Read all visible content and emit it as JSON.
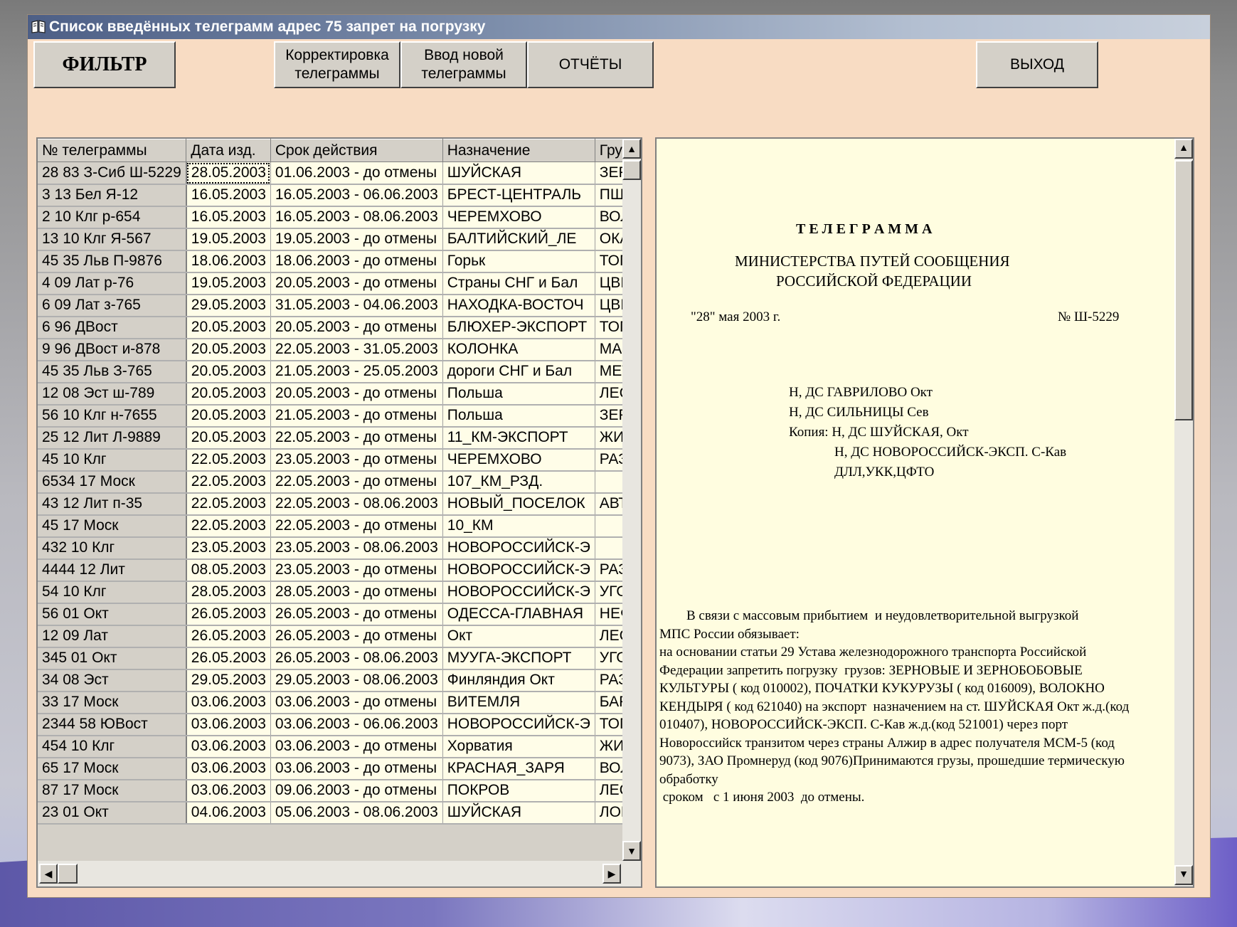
{
  "window": {
    "title": "Список введённых телеграмм  адрес 75 запрет на погрузку",
    "icon": "book-icon"
  },
  "toolbar": {
    "filter_label": "ФИЛЬТР",
    "edit_label": "Корректировка\nтелеграммы",
    "new_label": "Ввод новой\nтелеграммы",
    "reports_label": "ОТЧЁТЫ",
    "exit_label": "ВЫХОД"
  },
  "table": {
    "columns": [
      "№ телеграммы",
      "Дата изд.",
      "Срок действия",
      "Назначение",
      "Груз"
    ],
    "rows": [
      [
        "28 83 З-Сиб Ш-5229",
        "28.05.2003",
        "01.06.2003 - до отмены",
        "ШУЙСКАЯ",
        "ЗЕРНОВ"
      ],
      [
        "3 13 Бел Я-12",
        "16.05.2003",
        "16.05.2003 - 06.06.2003",
        "БРЕСТ-ЦЕНТРАЛЬ",
        "ПШЕНИЦ"
      ],
      [
        "2 10 Клг р-654",
        "16.05.2003",
        "16.05.2003 - 08.06.2003",
        "ЧЕРЕМХОВО",
        "ВОЛОКНО"
      ],
      [
        "13 10 Клг Я-567",
        "19.05.2003",
        "19.05.2003 - до отмены",
        "БАЛТИЙСКИЙ_ЛЕ",
        "ОКАТЫШ"
      ],
      [
        "45 35 Льв П-9876",
        "18.06.2003",
        "18.06.2003 - до отмены",
        "Горьк",
        "ТОПЛИВО"
      ],
      [
        "4 09 Лат р-76",
        "19.05.2003",
        "20.05.2003 - до отмены",
        "Страны СНГ и Бал",
        "ЦВЕТНЫ"
      ],
      [
        "6 09 Лат з-765",
        "29.05.2003",
        "31.05.2003 - 04.06.2003",
        "НАХОДКА-ВОСТОЧ",
        "ЦВЕТНЫ"
      ],
      [
        "6 96 ДВост",
        "20.05.2003",
        "20.05.2003 - до отмены",
        "БЛЮХЕР-ЭКСПОРТ",
        "ТОПЛИВО"
      ],
      [
        "9 96 ДВост и-878",
        "20.05.2003",
        "22.05.2003 - 31.05.2003",
        "КОЛОНКА",
        "МАЗУТ Н"
      ],
      [
        "45 35 Льв З-765",
        "20.05.2003",
        "21.05.2003 - 25.05.2003",
        "дороги СНГ и Бал",
        "МЕТАЛЛИ"
      ],
      [
        "12 08 Эст ш-789",
        "20.05.2003",
        "20.05.2003 - до отмены",
        "Польша",
        "ЛЕСМАТ"
      ],
      [
        "56 10 Клг н-7655",
        "20.05.2003",
        "21.05.2003 - до отмены",
        "Польша",
        "ЗЕРНО"
      ],
      [
        "25 12 Лит Л-9889",
        "20.05.2003",
        "22.05.2003 - до отмены",
        "11_КМ-ЭКСПОРТ",
        "ЖИВОТН"
      ],
      [
        "45 10 Клг",
        "22.05.2003",
        "23.05.2003 - до отмены",
        "ЧЕРЕМХОВО",
        "РАЗНЫЕ"
      ],
      [
        "6534 17 Моск",
        "22.05.2003",
        "22.05.2003 - до отмены",
        "107_КМ_РЗД.",
        ""
      ],
      [
        "43 12 Лит п-35",
        "22.05.2003",
        "22.05.2003 - 08.06.2003",
        "НОВЫЙ_ПОСЕЛОК",
        "АВТОМ И"
      ],
      [
        "45 17 Моск",
        "22.05.2003",
        "22.05.2003 - до отмены",
        "10_КМ",
        ""
      ],
      [
        "432 10 Клг",
        "23.05.2003",
        "23.05.2003 - 08.06.2003",
        "НОВОРОССИЙСК-Э",
        ""
      ],
      [
        "4444 12 Лит",
        "08.05.2003",
        "23.05.2003 - до отмены",
        "НОВОРОССИЙСК-Э",
        "РАЗНЫЕ"
      ],
      [
        "54 10 Клг",
        "28.05.2003",
        "28.05.2003 - до отмены",
        "НОВОРОССИЙСК-Э",
        "УГОЛЬ"
      ],
      [
        "56 01 Окт",
        "26.05.2003",
        "26.05.2003 - до отмены",
        "ОДЕССА-ГЛАВНАЯ",
        "НЕФТЬ С"
      ],
      [
        "12 09 Лат",
        "26.05.2003",
        "26.05.2003 - до отмены",
        "Окт",
        "ЛЕСНЫЕ"
      ],
      [
        "345 01 Окт",
        "26.05.2003",
        "26.05.2003 - 08.06.2003",
        "МУУГА-ЭКСПОРТ",
        "УГОЛЬ"
      ],
      [
        "34 08 Эст",
        "29.05.2003",
        "29.05.2003 - 08.06.2003",
        "Финляндия Окт",
        "РАЗНЫЕ"
      ],
      [
        "33 17 Моск",
        "03.06.2003",
        "03.06.2003 - до отмены",
        "ВИТЕМЛЯ",
        "БАРДА В"
      ],
      [
        "2344 58 ЮВост",
        "03.06.2003",
        "03.06.2003 - 06.06.2003",
        "НОВОРОССИЙСК-Э",
        "ТОПЛИВО"
      ],
      [
        "454 10 Клг",
        "03.06.2003",
        "03.06.2003 - до отмены",
        "Хорватия",
        "ЖИВОТН"
      ],
      [
        "65 17 Моск",
        "03.06.2003",
        "03.06.2003 - до отмены",
        "КРАСНАЯ_ЗАРЯ",
        "ВОЛОКНО"
      ],
      [
        "87 17 Моск",
        "03.06.2003",
        "09.06.2003 - до отмены",
        "ПОКРОВ",
        "ЛЕСНЫЕ"
      ],
      [
        "23 01 Окт",
        "04.06.2003",
        "05.06.2003 - 08.06.2003",
        "ШУЙСКАЯ",
        "ЛОМ СТ С"
      ]
    ]
  },
  "document": {
    "heading": "Т Е Л Е Г Р А М М А",
    "ministry_1": "МИНИСТЕРСТВА ПУТЕЙ СООБЩЕНИЯ",
    "ministry_2": "РОССИЙСКОЙ ФЕДЕРАЦИИ",
    "date": "\"28\" мая 2003 г.",
    "number": "№ Ш-5229",
    "addr_1": "Н, ДС ГАВРИЛОВО Окт",
    "addr_2": "Н, ДС СИЛЬНИЦЫ Сев",
    "addr_3": "Копия: Н, ДС  ШУЙСКАЯ, Окт",
    "addr_4": "Н, ДС  НОВОРОССИЙСК-ЭКСП. С-Кав",
    "addr_5": "ДЛЛ,УКК,ЦФТО",
    "body": [
      "        В связи с массовым прибытием  и неудовлетворительной выгрузкой",
      "МПС России обязывает:",
      "на основании статьи 29 Устава железнодорожного транспорта Российской",
      "Федерации запретить погрузку  грузов: ЗЕРНОВЫЕ И ЗЕРНОБОБОВЫЕ",
      "КУЛЬТУРЫ ( код 010002), ПОЧАТКИ КУКУРУЗЫ ( код 016009), ВОЛОКНО",
      "КЕНДЫРЯ ( код 621040) на экспорт  назначением на ст. ШУЙСКАЯ Окт ж.д.(код",
      "010407), НОВОРОССИЙСК-ЭКСП. С-Кав ж.д.(код 521001) через порт",
      "Новороссийск транзитом через страны Алжир в адрес получателя МСМ-5 (код",
      "9073), ЗАО Промнеруд (код 9076)Принимаются грузы, прошедшие термическую",
      "обработку",
      " сроком   с 1 июня 2003  до отмены."
    ]
  },
  "colors": {
    "window_bg": "#f8dcc3",
    "grid_cell": "#fffde8",
    "doc_bg": "#fffde0",
    "button_face": "#d4d0c8"
  }
}
